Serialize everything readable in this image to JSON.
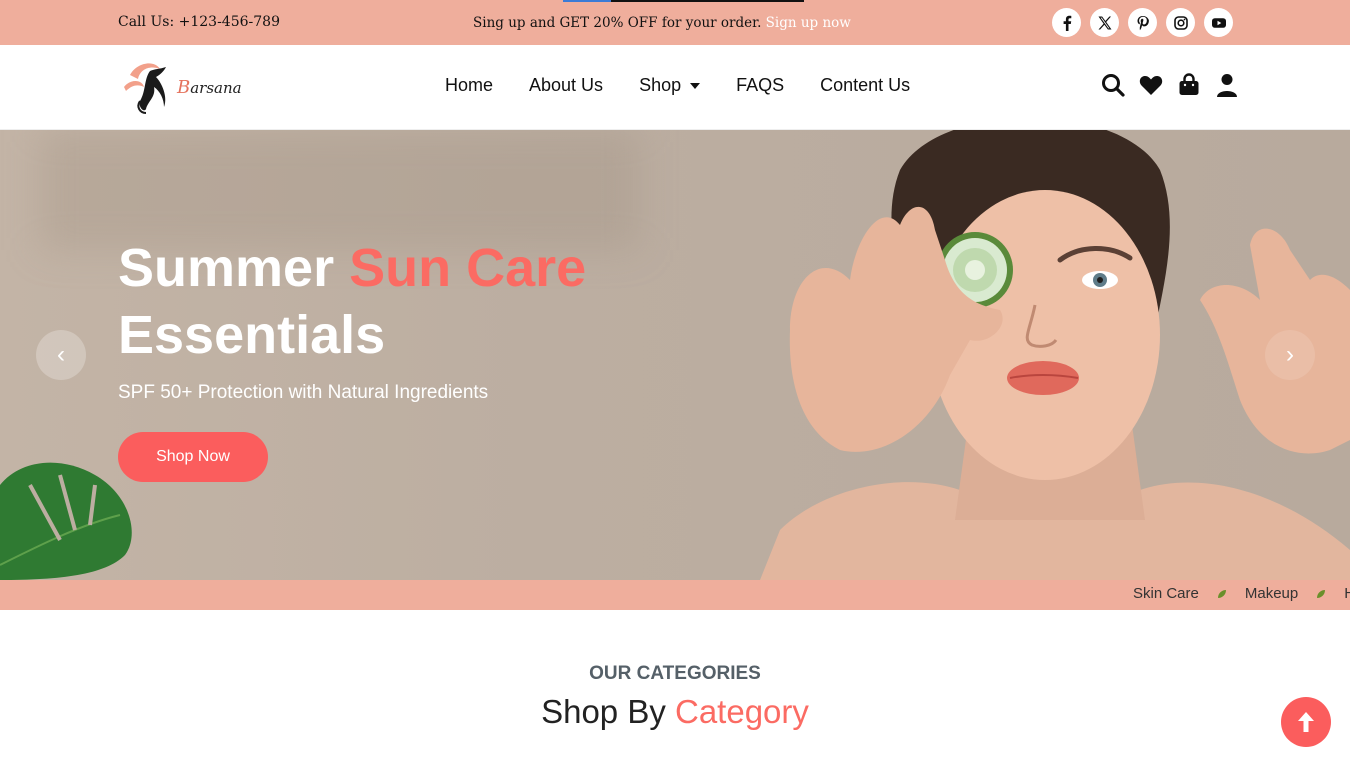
{
  "topbar": {
    "call": "Call Us: +123-456-789",
    "promo_text": "Sing up and GET 20% OFF for your order. ",
    "promo_link": "Sign up now",
    "socials": [
      "facebook-icon",
      "x-icon",
      "pinterest-icon",
      "instagram-icon",
      "youtube-icon"
    ]
  },
  "header": {
    "logo_initial": "B",
    "logo_word": "arsana",
    "nav": [
      "Home",
      "About Us",
      "Shop",
      "FAQS",
      "Content Us"
    ],
    "icons": [
      "search-icon",
      "heart-icon",
      "bag-icon",
      "user-icon"
    ]
  },
  "hero": {
    "title_part1": "Summer ",
    "title_accent": "Sun Care",
    "title_part2": "Essentials",
    "subtitle": "SPF 50+ Protection with Natural Ingredients",
    "button": "Shop Now",
    "prev": "‹",
    "next": "›"
  },
  "marquee": {
    "items": [
      "Skin Care",
      "Makeup",
      "H"
    ]
  },
  "categories": {
    "kicker": "OUR CATEGORIES",
    "title_part1": "Shop By ",
    "title_accent": "Category"
  },
  "colors": {
    "accent": "#fb6b63",
    "topbar_bg": "#efae9c",
    "button": "#fb5d5d"
  }
}
